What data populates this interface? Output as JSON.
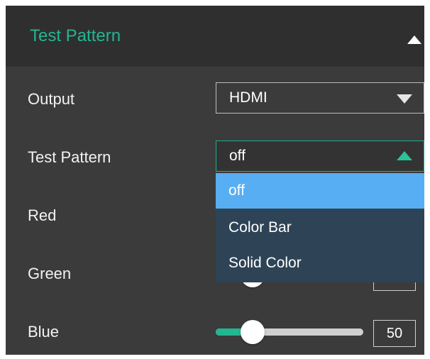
{
  "panel": {
    "title": "Test Pattern",
    "collapse_icon": "triangle-up-icon"
  },
  "output": {
    "label": "Output",
    "value": "HDMI"
  },
  "test_pattern": {
    "label": "Test Pattern",
    "value": "off",
    "options": [
      "off",
      "Color Bar",
      "Solid Color"
    ],
    "selected_index": 0
  },
  "red": {
    "label": "Red"
  },
  "green": {
    "label": "Green"
  },
  "blue": {
    "label": "Blue",
    "value": "50",
    "level": 0.25
  },
  "colors": {
    "accent": "#24b592",
    "panel_bg": "#3b3b3b",
    "header_bg": "#2f2f2f",
    "dropdown_bg": "#2e4456",
    "dropdown_selected": "#58aef2"
  }
}
